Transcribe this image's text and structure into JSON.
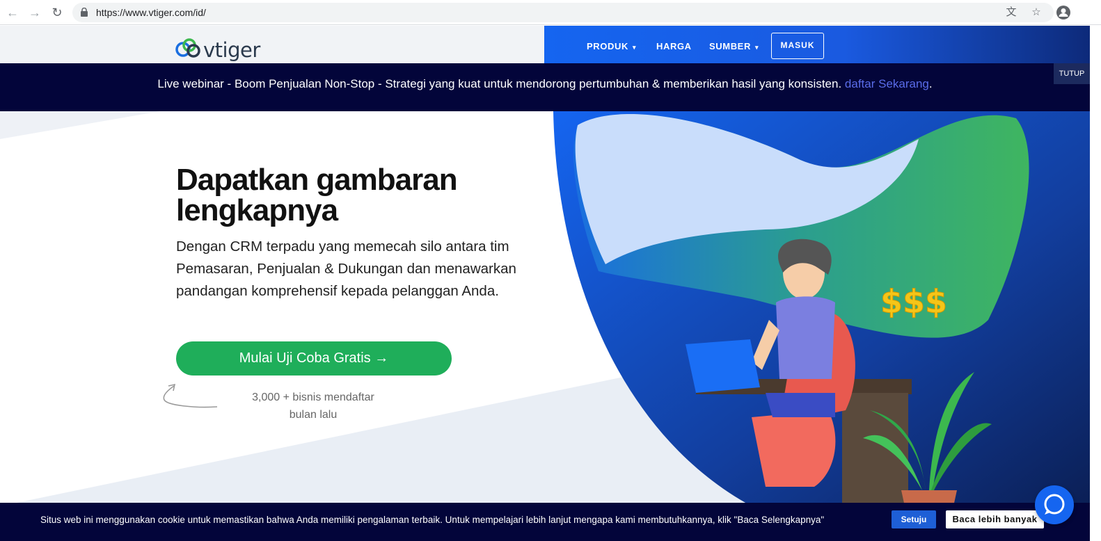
{
  "browser": {
    "url": "https://www.vtiger.com/id/",
    "icons": [
      "back-icon",
      "forward-icon",
      "reload-icon",
      "lock-icon",
      "translate-icon",
      "star-icon",
      "profile-icon"
    ]
  },
  "header": {
    "logo_text": "vtiger",
    "nav": [
      {
        "label": "PRODUK",
        "has_dropdown": true
      },
      {
        "label": "HARGA",
        "has_dropdown": false
      },
      {
        "label": "SUMBER",
        "has_dropdown": true
      }
    ],
    "caret": "▾",
    "login_label": "MASUK"
  },
  "webinar": {
    "text": "Live webinar - Boom Penjualan Non-Stop - Strategi yang kuat untuk mendorong pertumbuhan & memberikan hasil yang konsisten.",
    "link_text": "daftar Sekarang",
    "period": ".",
    "close_label": "TUTUP"
  },
  "hero": {
    "title_line1": "Dapatkan gambaran",
    "title_line2": "lengkapnya",
    "description": "Dengan CRM terpadu yang memecah silo antara tim Pemasaran, Penjualan & Dukungan dan menawarkan pandangan komprehensif kepada pelanggan Anda.",
    "cta_label": "Mulai Uji Coba Gratis →",
    "note_line1": "3,000 + bisnis mendaftar",
    "note_line2": "bulan lalu"
  },
  "illustration": {
    "dollar_text": "$$$"
  },
  "cookie": {
    "text": "Situs web ini menggunakan cookie untuk memastikan bahwa Anda memiliki pengalaman terbaik. Untuk mempelajari lebih lanjut mengapa kami membutuhkannya, klik \"Baca Selengkapnya\"",
    "accept_label": "Setuju",
    "more_label": "Baca lebih banyak"
  },
  "colors": {
    "brand_blue": "#1565f0",
    "navy": "#03053a",
    "cta_green": "#1fae5a",
    "link_blue": "#5a6ce8"
  }
}
